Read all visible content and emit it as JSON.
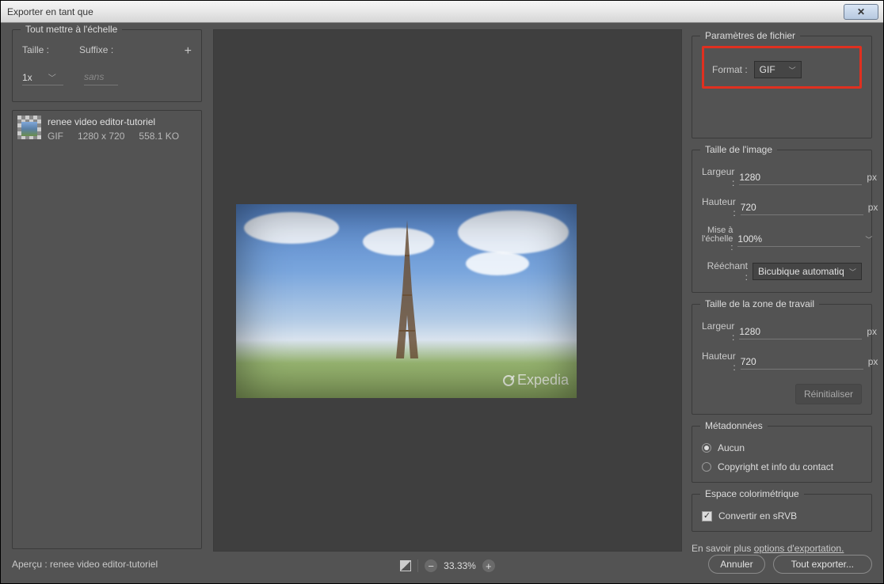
{
  "window": {
    "title": "Exporter en tant que"
  },
  "scale": {
    "legend": "Tout mettre à l'échelle",
    "size_label": "Taille :",
    "suffix_label": "Suffixe :",
    "size_value": "1x",
    "suffix_placeholder": "sans",
    "add_icon": "+"
  },
  "file": {
    "name": "renee video editor-tutoriel",
    "format": "GIF",
    "dimensions": "1280 x 720",
    "size": "558.1 KO"
  },
  "preview": {
    "watermark": "Expedia"
  },
  "zoom": {
    "value": "33.33%"
  },
  "file_settings": {
    "legend": "Paramètres de fichier",
    "format_label": "Format :",
    "format_value": "GIF"
  },
  "image_size": {
    "legend": "Taille de l'image",
    "width_label": "Largeur :",
    "width_value": "1280",
    "height_label": "Hauteur :",
    "height_value": "720",
    "scale_label": "Mise à l'échelle :",
    "scale_value": "100%",
    "resample_label": "Rééchant :",
    "resample_value": "Bicubique automatique",
    "unit": "px"
  },
  "canvas_size": {
    "legend": "Taille de la zone de travail",
    "width_label": "Largeur :",
    "width_value": "1280",
    "height_label": "Hauteur :",
    "height_value": "720",
    "unit": "px",
    "reset": "Réinitialiser"
  },
  "metadata": {
    "legend": "Métadonnées",
    "none": "Aucun",
    "copyright": "Copyright et info du contact"
  },
  "colorspace": {
    "legend": "Espace colorimétrique",
    "convert": "Convertir en sRVB"
  },
  "learn_more": {
    "prefix": "En savoir plus ",
    "link": "options d'exportation."
  },
  "footer": {
    "preview_label": "Aperçu :",
    "preview_file": "renee video editor-tutoriel",
    "cancel": "Annuler",
    "export_all": "Tout exporter..."
  }
}
